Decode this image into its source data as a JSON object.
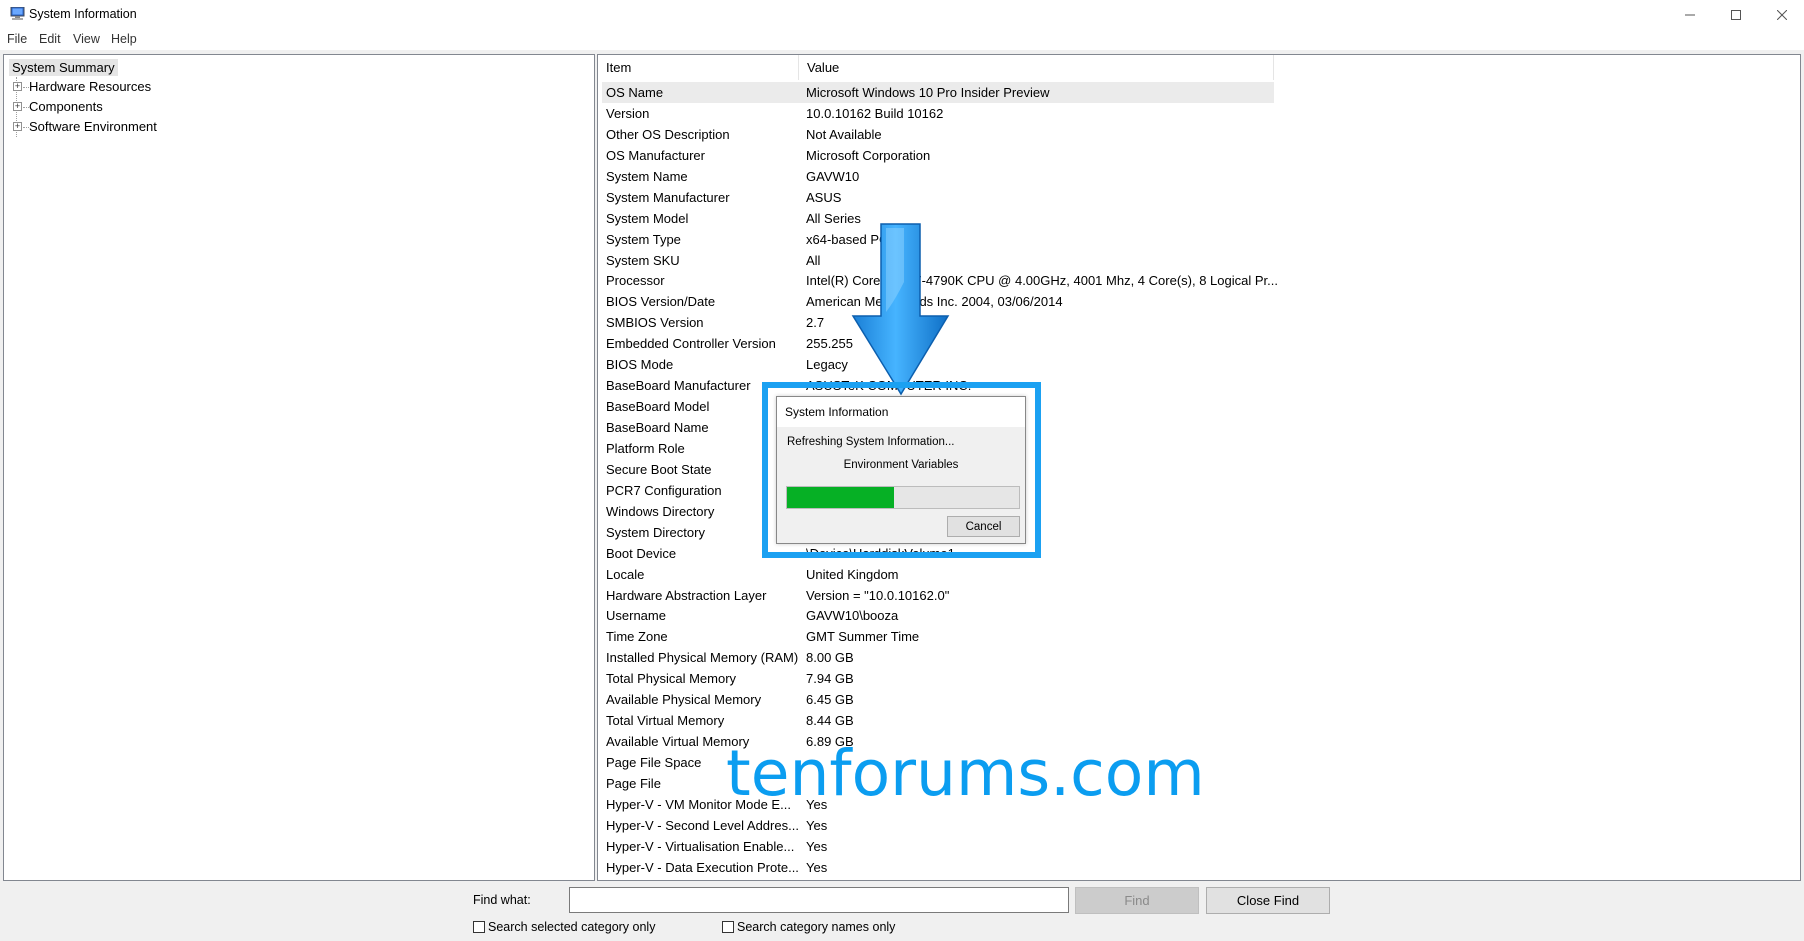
{
  "window": {
    "title": "System Information",
    "icon": "system-information-icon",
    "controls": [
      "minimize-icon",
      "maximize-icon",
      "close-icon"
    ]
  },
  "menu": {
    "items": [
      {
        "label": "File"
      },
      {
        "label": "Edit"
      },
      {
        "label": "View"
      },
      {
        "label": "Help"
      }
    ]
  },
  "tree": {
    "root": "System Summary",
    "children": [
      {
        "label": "Hardware Resources",
        "expander": "+"
      },
      {
        "label": "Components",
        "expander": "+"
      },
      {
        "label": "Software Environment",
        "expander": "+"
      }
    ]
  },
  "table": {
    "headers": {
      "item": "Item",
      "value": "Value"
    },
    "rows": [
      {
        "item": "OS Name",
        "value": "Microsoft Windows 10 Pro Insider Preview"
      },
      {
        "item": "Version",
        "value": "10.0.10162 Build 10162"
      },
      {
        "item": "Other OS Description",
        "value": "Not Available"
      },
      {
        "item": "OS Manufacturer",
        "value": "Microsoft Corporation"
      },
      {
        "item": "System Name",
        "value": "GAVW10"
      },
      {
        "item": "System Manufacturer",
        "value": "ASUS"
      },
      {
        "item": "System Model",
        "value": "All Series"
      },
      {
        "item": "System Type",
        "value": "x64-based PC"
      },
      {
        "item": "System SKU",
        "value": "All"
      },
      {
        "item": "Processor",
        "value": "Intel(R) Core(TM) i7-4790K CPU @ 4.00GHz, 4001 Mhz, 4 Core(s), 8 Logical Pr..."
      },
      {
        "item": "BIOS Version/Date",
        "value": "American Megatrends Inc. 2004, 03/06/2014"
      },
      {
        "item": "SMBIOS Version",
        "value": "2.7"
      },
      {
        "item": "Embedded Controller Version",
        "value": "255.255"
      },
      {
        "item": "BIOS Mode",
        "value": "Legacy"
      },
      {
        "item": "BaseBoard Manufacturer",
        "value": "ASUSTeK COMPUTER INC."
      },
      {
        "item": "BaseBoard Model",
        "value": ""
      },
      {
        "item": "BaseBoard Name",
        "value": ""
      },
      {
        "item": "Platform Role",
        "value": ""
      },
      {
        "item": "Secure Boot State",
        "value": ""
      },
      {
        "item": "PCR7 Configuration",
        "value": ""
      },
      {
        "item": "Windows Directory",
        "value": ""
      },
      {
        "item": "System Directory",
        "value": ""
      },
      {
        "item": "Boot Device",
        "value": "\\Device\\HarddiskVolume1"
      },
      {
        "item": "Locale",
        "value": "United Kingdom"
      },
      {
        "item": "Hardware Abstraction Layer",
        "value": "Version = \"10.0.10162.0\""
      },
      {
        "item": "Username",
        "value": "GAVW10\\booza"
      },
      {
        "item": "Time Zone",
        "value": "GMT Summer Time"
      },
      {
        "item": "Installed Physical Memory (RAM)",
        "value": "8.00 GB"
      },
      {
        "item": "Total Physical Memory",
        "value": "7.94 GB"
      },
      {
        "item": "Available Physical Memory",
        "value": "6.45 GB"
      },
      {
        "item": "Total Virtual Memory",
        "value": "8.44 GB"
      },
      {
        "item": "Available Virtual Memory",
        "value": "6.89 GB"
      },
      {
        "item": "Page File Space",
        "value": ""
      },
      {
        "item": "Page File",
        "value": ""
      },
      {
        "item": "Hyper-V - VM Monitor Mode E...",
        "value": "Yes"
      },
      {
        "item": "Hyper-V - Second Level Addres...",
        "value": "Yes"
      },
      {
        "item": "Hyper-V - Virtualisation Enable...",
        "value": "Yes"
      },
      {
        "item": "Hyper-V - Data Execution Prote...",
        "value": "Yes"
      }
    ]
  },
  "find": {
    "label": "Find what:",
    "value": "",
    "find_button": "Find",
    "close_button": "Close Find",
    "checkbox_selected_category": "Search selected category only",
    "checkbox_category_names": "Search category names only"
  },
  "dialog": {
    "title": "System Information",
    "message": "Refreshing System Information...",
    "status": "Environment Variables",
    "progress_percent": 46,
    "cancel_label": "Cancel",
    "progress_color": "#06b025"
  },
  "annotation": {
    "highlight_color": "#1ba1f2",
    "arrow": "down-arrow-icon"
  },
  "watermark": {
    "text": "tenforums.com",
    "color": "#0b9df0"
  }
}
